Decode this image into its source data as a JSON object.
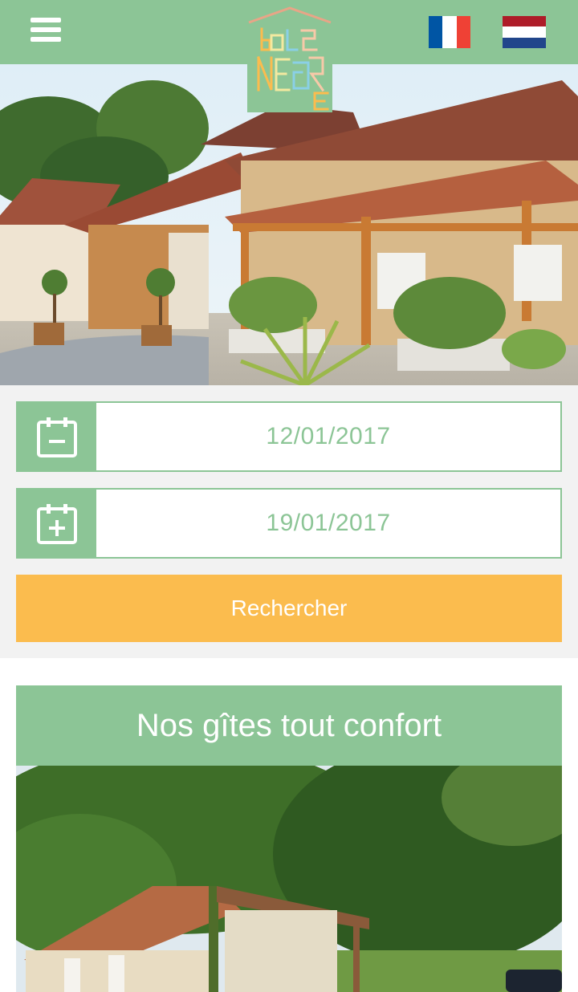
{
  "header": {
    "menu_icon": "hamburger-menu-icon",
    "logo_text_lines": [
      "BOIS",
      "NÈGRE"
    ],
    "languages": [
      {
        "code": "fr",
        "colors": [
          "#0055a4",
          "#ffffff",
          "#ef4135"
        ]
      },
      {
        "code": "nl",
        "colors": [
          "#ae1c28",
          "#ffffff",
          "#21468b"
        ]
      }
    ]
  },
  "search": {
    "arrival_date": "12/01/2017",
    "departure_date": "19/01/2017",
    "arrival_icon": "calendar-minus-icon",
    "departure_icon": "calendar-plus-icon",
    "submit_label": "Rechercher"
  },
  "section": {
    "title": "Nos gîtes tout confort"
  },
  "colors": {
    "primary_green": "#8cc596",
    "accent_yellow": "#fbbc4e",
    "background": "#f2f2f2"
  }
}
